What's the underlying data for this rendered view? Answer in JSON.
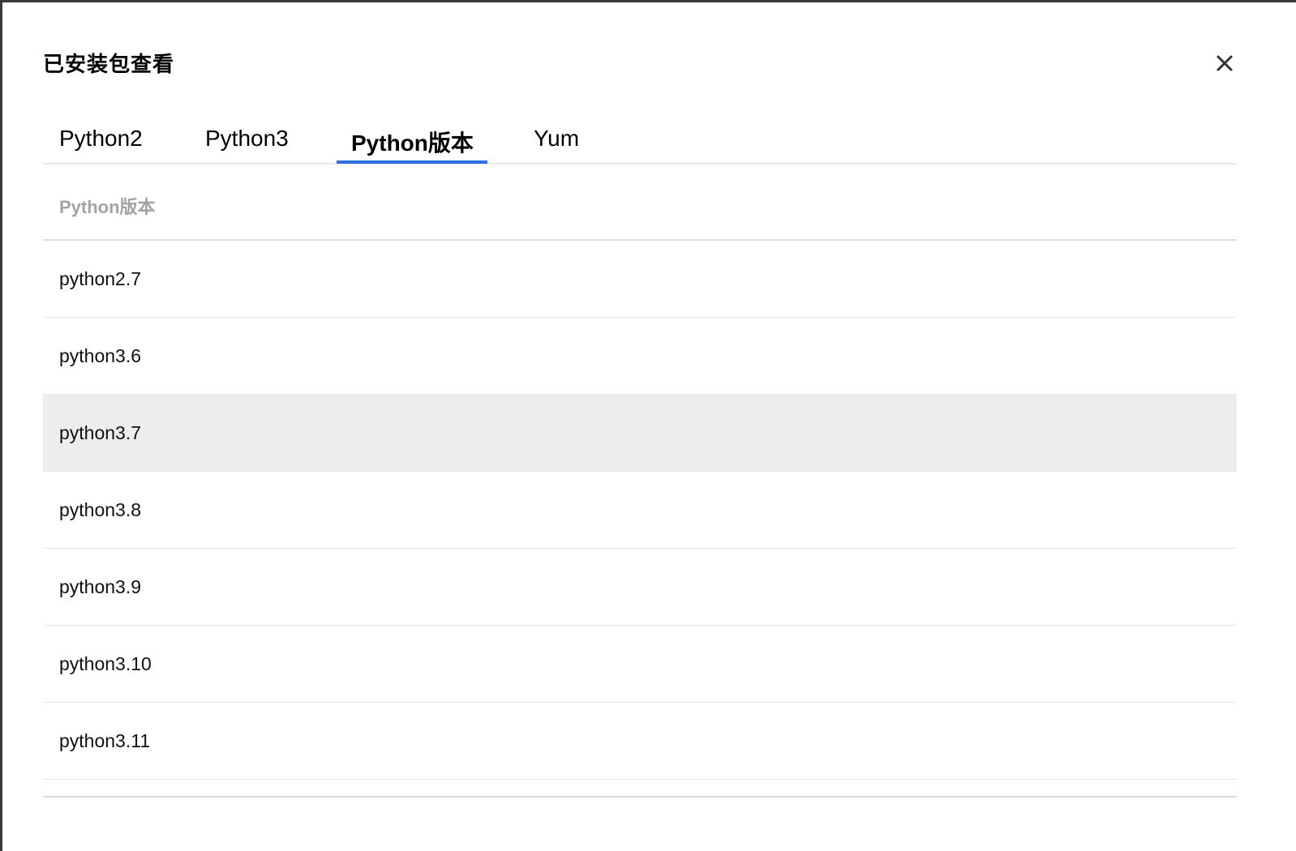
{
  "dialog": {
    "title": "已安装包查看",
    "close_icon": "close-icon"
  },
  "tabs": [
    {
      "label": "Python2",
      "active": false
    },
    {
      "label": "Python3",
      "active": false
    },
    {
      "label": "Python版本",
      "active": true
    },
    {
      "label": "Yum",
      "active": false
    }
  ],
  "table": {
    "header": "Python版本",
    "rows": [
      "python2.7",
      "python3.6",
      "python3.7",
      "python3.8",
      "python3.9",
      "python3.10",
      "python3.11"
    ],
    "hovered_row": "python3.7"
  },
  "colors": {
    "accent": "#2f6fe0",
    "hover_row": "#ecedef",
    "header_text": "#a3a3a3"
  }
}
